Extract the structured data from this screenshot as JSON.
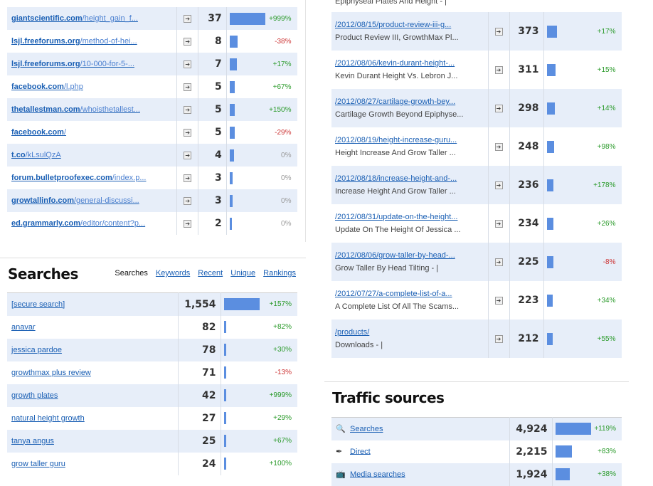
{
  "referrers": [
    {
      "domain": "giantscientific.com",
      "path": "/height_gain_f...",
      "count": "37",
      "bar": 1.0,
      "change": "+999%",
      "trend": "pos"
    },
    {
      "domain": "lsjl.freeforums.org",
      "path": "/method-of-hei...",
      "count": "8",
      "bar": 0.22,
      "change": "-38%",
      "trend": "neg"
    },
    {
      "domain": "lsjl.freeforums.org",
      "path": "/10-000-for-5-...",
      "count": "7",
      "bar": 0.19,
      "change": "+17%",
      "trend": "pos"
    },
    {
      "domain": "facebook.com",
      "path": "/l.php",
      "count": "5",
      "bar": 0.14,
      "change": "+67%",
      "trend": "pos"
    },
    {
      "domain": "thetallestman.com",
      "path": "/whoisthetallest...",
      "count": "5",
      "bar": 0.14,
      "change": "+150%",
      "trend": "pos"
    },
    {
      "domain": "facebook.com",
      "path": "/",
      "count": "5",
      "bar": 0.14,
      "change": "-29%",
      "trend": "neg"
    },
    {
      "domain": "t.co",
      "path": "/kLsulQzA",
      "count": "4",
      "bar": 0.11,
      "change": "0%",
      "trend": "zero"
    },
    {
      "domain": "forum.bulletproofexec.com",
      "path": "/index.p...",
      "count": "3",
      "bar": 0.08,
      "change": "0%",
      "trend": "zero"
    },
    {
      "domain": "growtallinfo.com",
      "path": "/general-discussi...",
      "count": "3",
      "bar": 0.08,
      "change": "0%",
      "trend": "zero"
    },
    {
      "domain": "ed.grammarly.com",
      "path": "/editor/content?p...",
      "count": "2",
      "bar": 0.05,
      "change": "0%",
      "trend": "zero"
    }
  ],
  "searches": {
    "title": "Searches",
    "tabs": {
      "active": "Searches",
      "keywords": "Keywords",
      "recent": "Recent",
      "unique": "Unique",
      "rankings": "Rankings"
    },
    "rows": [
      {
        "term": "[secure search]",
        "count": "1,554",
        "bar": 1.0,
        "change": "+157%",
        "trend": "pos"
      },
      {
        "term": "anavar",
        "count": "82",
        "bar": 0.05,
        "change": "+82%",
        "trend": "pos"
      },
      {
        "term": "jessica pardoe",
        "count": "78",
        "bar": 0.05,
        "change": "+30%",
        "trend": "pos"
      },
      {
        "term": "growthmax plus review",
        "count": "71",
        "bar": 0.05,
        "change": "-13%",
        "trend": "neg"
      },
      {
        "term": "growth plates",
        "count": "42",
        "bar": 0.03,
        "change": "+999%",
        "trend": "pos"
      },
      {
        "term": "natural height growth",
        "count": "27",
        "bar": 0.02,
        "change": "+29%",
        "trend": "pos"
      },
      {
        "term": "tanya angus",
        "count": "25",
        "bar": 0.02,
        "change": "+67%",
        "trend": "pos"
      },
      {
        "term": "grow taller guru",
        "count": "24",
        "bar": 0.02,
        "change": "+100%",
        "trend": "pos"
      }
    ]
  },
  "pages": {
    "top_cutoff": "Epiphyseal Plates And Height - |",
    "rows": [
      {
        "path": "/2012/08/15/product-review-iii-g...",
        "title": "Product Review III, GrowthMax Pl...",
        "count": "373",
        "bar": 0.45,
        "change": "+17%",
        "trend": "pos"
      },
      {
        "path": "/2012/08/06/kevin-durant-height-...",
        "title": "Kevin Durant Height Vs. Lebron J...",
        "count": "311",
        "bar": 0.4,
        "change": "+15%",
        "trend": "pos"
      },
      {
        "path": "/2012/08/27/cartilage-growth-bey...",
        "title": "Cartilage Growth Beyond Epiphyse...",
        "count": "298",
        "bar": 0.38,
        "change": "+14%",
        "trend": "pos"
      },
      {
        "path": "/2012/08/19/height-increase-guru...",
        "title": "Height Increase And Grow Taller ...",
        "count": "248",
        "bar": 0.32,
        "change": "+98%",
        "trend": "pos"
      },
      {
        "path": "/2012/08/18/increase-height-and-...",
        "title": "Increase Height And Grow Taller ...",
        "count": "236",
        "bar": 0.3,
        "change": "+178%",
        "trend": "pos"
      },
      {
        "path": "/2012/08/31/update-on-the-height...",
        "title": "Update On The Height Of Jessica ...",
        "count": "234",
        "bar": 0.3,
        "change": "+26%",
        "trend": "pos"
      },
      {
        "path": "/2012/08/06/grow-taller-by-head-...",
        "title": "Grow Taller By Head Tilting - |",
        "count": "225",
        "bar": 0.29,
        "change": "-8%",
        "trend": "neg"
      },
      {
        "path": "/2012/07/27/a-complete-list-of-a...",
        "title": "A Complete List Of All The Scams...",
        "count": "223",
        "bar": 0.28,
        "change": "+34%",
        "trend": "pos"
      },
      {
        "path": "/products/",
        "title": "Downloads - |",
        "count": "212",
        "bar": 0.27,
        "change": "+55%",
        "trend": "pos"
      }
    ]
  },
  "traffic_sources": {
    "title": "Traffic sources",
    "rows": [
      {
        "icon": "magnifier-icon",
        "label": "Searches",
        "count": "4,924",
        "bar": 1.0,
        "change": "+119%",
        "trend": "pos"
      },
      {
        "icon": "direct-icon",
        "label": "Direct",
        "count": "2,215",
        "bar": 0.45,
        "change": "+83%",
        "trend": "pos"
      },
      {
        "icon": "tv-icon",
        "label": "Media searches",
        "count": "1,924",
        "bar": 0.39,
        "change": "+38%",
        "trend": "pos"
      }
    ]
  },
  "colors": {
    "bar": "#5b8ee0",
    "row_alt": "#e7eef9",
    "positive": "#2a9a2a",
    "negative": "#cc3333",
    "link": "#1a5fb4"
  }
}
